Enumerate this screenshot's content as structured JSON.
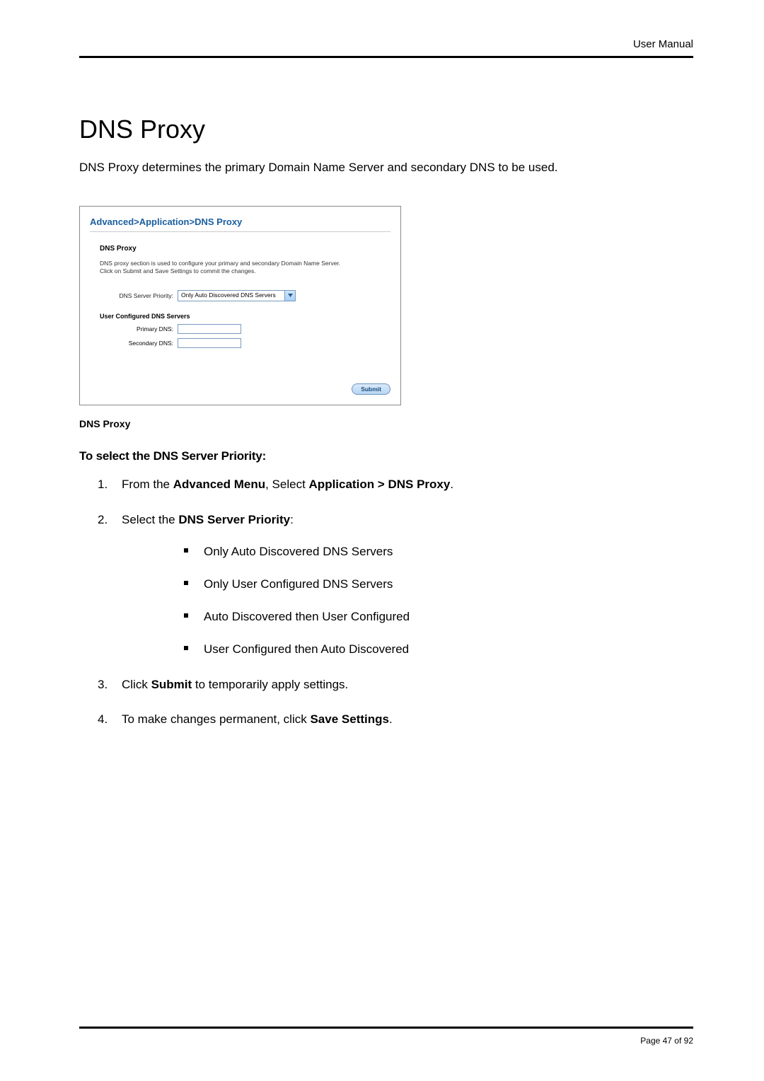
{
  "header": {
    "right": "User Manual"
  },
  "title": "DNS Proxy",
  "intro": "DNS Proxy determines the primary Domain Name Server and secondary DNS to be used.",
  "screenshot": {
    "breadcrumb": "Advanced>Application>DNS Proxy",
    "section": "DNS Proxy",
    "blurb1": "DNS proxy section is used to configure your primary and secondary Domain Name Server.",
    "blurb2": "Click on Submit and Save Settings to commit the changes.",
    "priority_label": "DNS Server Priority:",
    "priority_value": "Only Auto Discovered DNS Servers",
    "user_conf_head": "User Configured DNS Servers",
    "primary_label": "Primary DNS:",
    "secondary_label": "Secondary DNS:",
    "primary_value": "",
    "secondary_value": "",
    "submit": "Submit"
  },
  "caption": "DNS Proxy",
  "howto": "To select the DNS Server Priority:",
  "steps": {
    "s1a": "From the ",
    "s1b": "Advanced Menu",
    "s1c": ", Select ",
    "s1d": "Application > DNS Proxy",
    "s1e": ".",
    "s2a": "Select the ",
    "s2b": "DNS Server Priority",
    "s2c": ":",
    "s3a": "Click ",
    "s3b": "Submit",
    "s3c": " to temporarily apply settings.",
    "s4a": "To make changes permanent, click ",
    "s4b": "Save Settings",
    "s4c": "."
  },
  "options": {
    "o1": "Only Auto Discovered DNS Servers",
    "o2": "Only User Configured DNS Servers",
    "o3": "Auto Discovered then User Configured",
    "o4": "User Configured then Auto Discovered"
  },
  "footer": {
    "page": "Page 47 of 92"
  }
}
